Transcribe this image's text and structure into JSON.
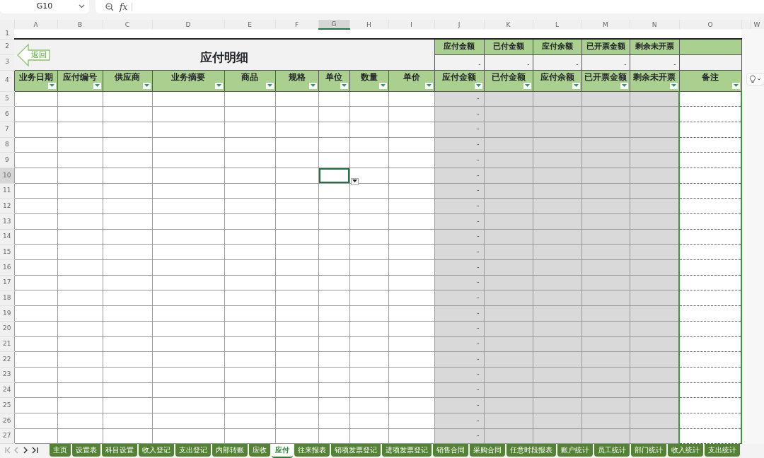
{
  "name_box": {
    "value": "G10"
  },
  "formula_bar": {
    "fx": "fx"
  },
  "column_headers": [
    {
      "label": "A",
      "selected": false
    },
    {
      "label": "B",
      "selected": false
    },
    {
      "label": "C",
      "selected": false
    },
    {
      "label": "D",
      "selected": false
    },
    {
      "label": "E",
      "selected": false
    },
    {
      "label": "F",
      "selected": false
    },
    {
      "label": "G",
      "selected": true
    },
    {
      "label": "H",
      "selected": false
    },
    {
      "label": "I",
      "selected": false
    },
    {
      "label": "J",
      "selected": false
    },
    {
      "label": "K",
      "selected": false
    },
    {
      "label": "L",
      "selected": false
    },
    {
      "label": "M",
      "selected": false
    },
    {
      "label": "N",
      "selected": false
    },
    {
      "label": "O",
      "selected": false
    },
    {
      "label": "W",
      "selected": false
    }
  ],
  "back_button": {
    "label": "返回"
  },
  "title": "应付明细",
  "summary": [
    {
      "label": "应付金额",
      "value": "-"
    },
    {
      "label": "已付金额",
      "value": "-"
    },
    {
      "label": "应付余额",
      "value": "-"
    },
    {
      "label": "已开票金额",
      "value": "-"
    },
    {
      "label": "剩余未开票",
      "value": "-"
    }
  ],
  "row_numbers": [
    {
      "label": "1",
      "selected": false
    },
    {
      "label": "2",
      "selected": false
    },
    {
      "label": "3",
      "selected": false
    },
    {
      "label": "4",
      "selected": false
    }
  ],
  "columns": [
    {
      "label": "业务日期",
      "kind": "input"
    },
    {
      "label": "应付编号",
      "kind": "input"
    },
    {
      "label": "供应商",
      "kind": "input"
    },
    {
      "label": "业务摘要",
      "kind": "input"
    },
    {
      "label": "商品",
      "kind": "input"
    },
    {
      "label": "规格",
      "kind": "input"
    },
    {
      "label": "单位",
      "kind": "input"
    },
    {
      "label": "数量",
      "kind": "input"
    },
    {
      "label": "单价",
      "kind": "input"
    },
    {
      "label": "应付金额",
      "kind": "computed"
    },
    {
      "label": "已付金额",
      "kind": "computed"
    },
    {
      "label": "应付余额",
      "kind": "computed"
    },
    {
      "label": "已开票金额",
      "kind": "computed"
    },
    {
      "label": "剩余未开票",
      "kind": "computed"
    },
    {
      "label": "备注",
      "kind": "note"
    }
  ],
  "rows": [
    {
      "number": "5",
      "selected": false,
      "amount": "-"
    },
    {
      "number": "6",
      "selected": false,
      "amount": "-"
    },
    {
      "number": "7",
      "selected": false,
      "amount": "-"
    },
    {
      "number": "8",
      "selected": false,
      "amount": "-"
    },
    {
      "number": "9",
      "selected": false,
      "amount": "-"
    },
    {
      "number": "10",
      "selected": true,
      "amount": "-"
    },
    {
      "number": "11",
      "selected": false,
      "amount": "-"
    },
    {
      "number": "12",
      "selected": false,
      "amount": "-"
    },
    {
      "number": "13",
      "selected": false,
      "amount": "-"
    },
    {
      "number": "14",
      "selected": false,
      "amount": "-"
    },
    {
      "number": "15",
      "selected": false,
      "amount": "-"
    },
    {
      "number": "16",
      "selected": false,
      "amount": "-"
    },
    {
      "number": "17",
      "selected": false,
      "amount": "-"
    },
    {
      "number": "18",
      "selected": false,
      "amount": "-"
    },
    {
      "number": "19",
      "selected": false,
      "amount": "-"
    },
    {
      "number": "20",
      "selected": false,
      "amount": "-"
    },
    {
      "number": "21",
      "selected": false,
      "amount": "-"
    },
    {
      "number": "22",
      "selected": false,
      "amount": "-"
    },
    {
      "number": "23",
      "selected": false,
      "amount": "-"
    },
    {
      "number": "24",
      "selected": false,
      "amount": "-"
    },
    {
      "number": "25",
      "selected": false,
      "amount": "-"
    },
    {
      "number": "26",
      "selected": false,
      "amount": "-"
    },
    {
      "number": "27",
      "selected": false,
      "amount": "-"
    }
  ],
  "sheet_tabs": [
    {
      "label": "主页",
      "selected": false
    },
    {
      "label": "设置表",
      "selected": false
    },
    {
      "label": "科目设置",
      "selected": false
    },
    {
      "label": "收入登记",
      "selected": false
    },
    {
      "label": "支出登记",
      "selected": false
    },
    {
      "label": "内部转账",
      "selected": false
    },
    {
      "label": "应收",
      "selected": false
    },
    {
      "label": "应付",
      "selected": true
    },
    {
      "label": "往来报表",
      "selected": false
    },
    {
      "label": "销项发票登记",
      "selected": false
    },
    {
      "label": "进项发票登记",
      "selected": false
    },
    {
      "label": "销售合同",
      "selected": false
    },
    {
      "label": "采购合同",
      "selected": false
    },
    {
      "label": "任意时段报表",
      "selected": false
    },
    {
      "label": "账户统计",
      "selected": false
    },
    {
      "label": "员工统计",
      "selected": false
    },
    {
      "label": "部门统计",
      "selected": false
    },
    {
      "label": "收入统计",
      "selected": false
    },
    {
      "label": "支出统计",
      "selected": false
    }
  ]
}
